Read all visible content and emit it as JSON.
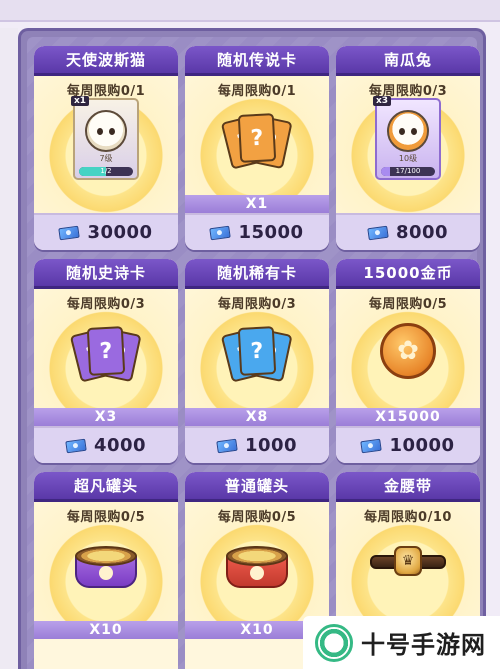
{
  "shop": {
    "items": [
      {
        "name": "天使波斯猫",
        "limit": "每周限购0/1",
        "type": "hero",
        "count_badge": "x1",
        "hero_level": "7级",
        "hero_progress_text": "1/2",
        "hero_progress_fraction": 0.5,
        "price": "30000",
        "qty": ""
      },
      {
        "name": "随机传说卡",
        "limit": "每周限购0/1",
        "type": "cards",
        "card_color": "#f2a142",
        "qty": "X1",
        "price": "15000"
      },
      {
        "name": "南瓜兔",
        "limit": "每周限购0/3",
        "type": "hero",
        "count_badge": "x3",
        "hero_level": "10级",
        "hero_progress_text": "17/100",
        "hero_progress_fraction": 0.17,
        "price": "8000",
        "qty": ""
      },
      {
        "name": "随机史诗卡",
        "limit": "每周限购0/3",
        "type": "cards",
        "card_color": "#9a6ae0",
        "qty": "X3",
        "price": "4000"
      },
      {
        "name": "随机稀有卡",
        "limit": "每周限购0/3",
        "type": "cards",
        "card_color": "#4aa8ee",
        "qty": "X8",
        "price": "1000"
      },
      {
        "name": "15000金币",
        "limit": "每周限购0/5",
        "type": "coin",
        "qty": "X15000",
        "price": "10000"
      },
      {
        "name": "超凡罐头",
        "limit": "每周限购0/5",
        "type": "can-purple",
        "qty": "X10",
        "price": ""
      },
      {
        "name": "普通罐头",
        "limit": "每周限购0/5",
        "type": "can-red",
        "qty": "X10",
        "price": ""
      },
      {
        "name": "金腰带",
        "limit": "每周限购0/10",
        "type": "belt",
        "qty": "",
        "price": ""
      }
    ]
  },
  "icons": {
    "currency": "ticket-icon",
    "coin": "paw-coin-icon"
  },
  "watermark": {
    "text": "十号手游网"
  },
  "colors": {
    "header": "#6a46b9",
    "price_bg": "#ddd3f2",
    "qty_bar": "#a98de2"
  }
}
